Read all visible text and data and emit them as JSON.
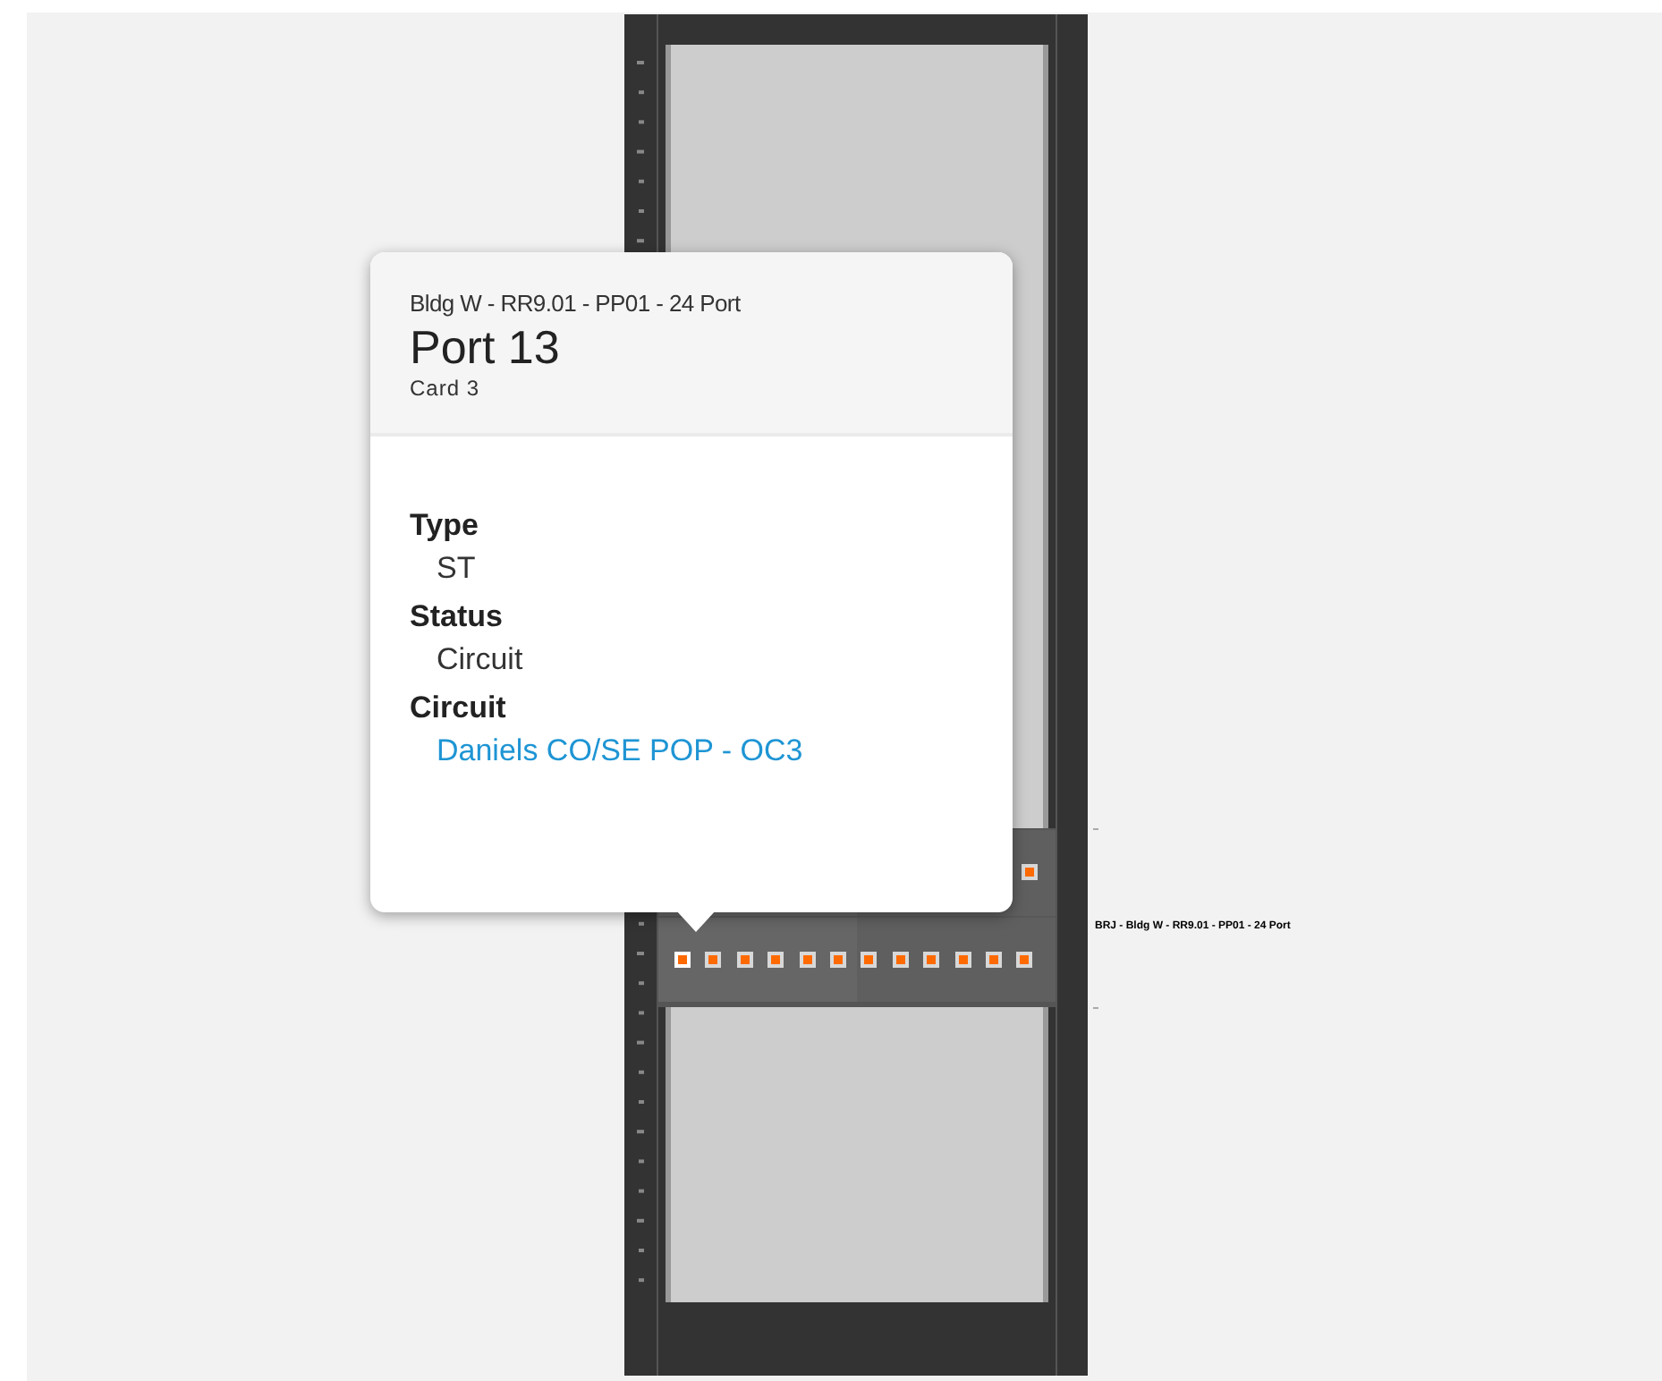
{
  "patch_panel": {
    "label": "BRJ - Bldg W - RR9.01 - PP01 - 24 Port",
    "rows": [
      {
        "ports": [
          {
            "selected": false
          }
        ]
      },
      {
        "ports": [
          {
            "selected": true
          },
          {
            "selected": false
          },
          {
            "selected": false
          },
          {
            "selected": false
          },
          {
            "selected": false
          },
          {
            "selected": false
          },
          {
            "selected": false
          },
          {
            "selected": false
          },
          {
            "selected": false
          },
          {
            "selected": false
          },
          {
            "selected": false
          },
          {
            "selected": false
          }
        ]
      }
    ]
  },
  "popover": {
    "subtitle": "Bldg W - RR9.01 - PP01 - 24 Port",
    "title": "Port 13",
    "caption": "Card 3",
    "fields": [
      {
        "label": "Type",
        "value": "ST",
        "kind": "text"
      },
      {
        "label": "Status",
        "value": "Circuit",
        "kind": "text"
      },
      {
        "label": "Circuit",
        "value": "Daniels CO/SE POP - OC3",
        "kind": "link"
      }
    ]
  }
}
